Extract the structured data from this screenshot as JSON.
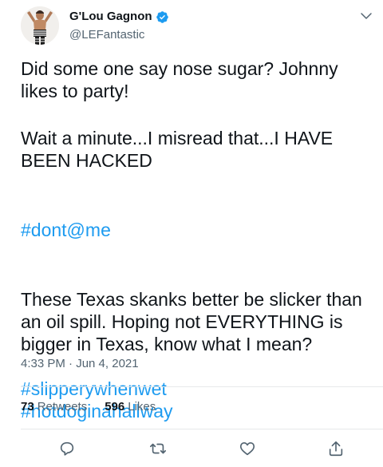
{
  "author": {
    "display_name": "G'Lou Gagnon",
    "handle": "@LEFantastic",
    "verified": true
  },
  "tweet": {
    "paragraphs": [
      "Did some one say nose sugar? Johnny likes to party!",
      "Wait a minute...I misread that...I HAVE BEEN HACKED"
    ],
    "hashtag_line": "#dont@me",
    "final_text": "These Texas skanks better be slicker than an oil spill. Hoping not EVERYTHING is bigger in Texas, know what I mean?",
    "final_hashtags": [
      "#slipperywhenwet",
      "#hotdoginahallway"
    ],
    "timestamp": "4:33 PM · Jun 4, 2021"
  },
  "stats": {
    "retweets_count": "73",
    "retweets_label": "Retweets",
    "likes_count": "596",
    "likes_label": "Likes"
  },
  "icons": {
    "verified": "verified-badge-icon",
    "more": "chevron-down-icon",
    "reply": "reply-icon",
    "retweet": "retweet-icon",
    "like": "heart-icon",
    "share": "share-icon"
  },
  "colors": {
    "link": "#1d9bf0",
    "secondary_text": "#536471",
    "primary_text": "#0f1419",
    "divider": "#e7e9ea"
  }
}
